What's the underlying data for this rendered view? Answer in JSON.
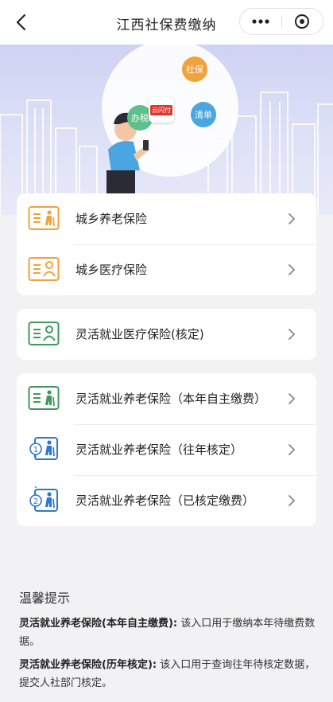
{
  "nav": {
    "title": "江西社保费缴纳"
  },
  "banner": {
    "bubbles": [
      "办税",
      "社保",
      "清单"
    ],
    "app_badge": "云闪付",
    "colors": {
      "green": "#5ec08a",
      "orange": "#f0a23c",
      "blue": "#4aa6e0",
      "red": "#e0342e"
    }
  },
  "cards": [
    {
      "items": [
        {
          "label": "城乡养老保险",
          "icon": "pension-card-icon",
          "color": "#f0a23c"
        },
        {
          "label": "城乡医疗保险",
          "icon": "medical-card-icon",
          "color": "#f0a23c"
        }
      ]
    },
    {
      "items": [
        {
          "label": "灵活就业医疗保险(核定)",
          "icon": "medical-card-icon",
          "color": "#3d9a5a"
        }
      ]
    },
    {
      "items": [
        {
          "label": "灵活就业养老保险（本年自主缴费）",
          "icon": "pension-card-icon",
          "color": "#3d9a5a"
        },
        {
          "label": "灵活就业养老保险（往年核定）",
          "icon": "step-1-pension-icon",
          "color": "#2f77c8",
          "step": "1"
        },
        {
          "label": "灵活就业养老保险（已核定缴费）",
          "icon": "step-2-pension-icon",
          "color": "#2f77c8",
          "step": "2"
        }
      ]
    }
  ],
  "tips": {
    "title": "温馨提示",
    "items": [
      {
        "name": "灵活就业养老保险(本年自主缴费):",
        "desc": " 该入口用于缴纳本年待缴费数据。"
      },
      {
        "name": "灵活就业养老保险(历年核定):",
        "desc": " 该入口用于查询往年待核定数据，提交人社部门核定。"
      }
    ]
  }
}
